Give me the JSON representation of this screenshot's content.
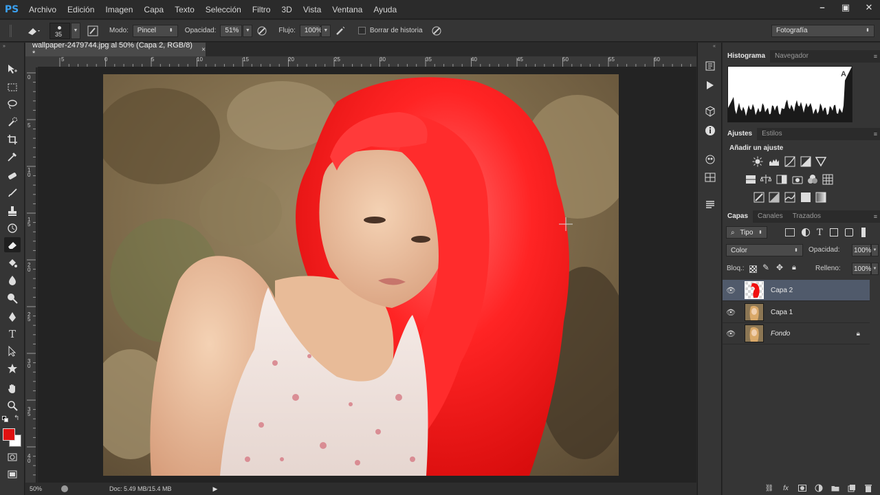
{
  "app": {
    "logo": "PS"
  },
  "menu": [
    "Archivo",
    "Edición",
    "Imagen",
    "Capa",
    "Texto",
    "Selección",
    "Filtro",
    "3D",
    "Vista",
    "Ventana",
    "Ayuda"
  ],
  "window_controls": [
    "–",
    "▣",
    "✕"
  ],
  "options": {
    "brush_size": "35",
    "mode_label": "Modo:",
    "mode_value": "Pincel",
    "opacity_label": "Opacidad:",
    "opacity_value": "51%",
    "flow_label": "Flujo:",
    "flow_value": "100%",
    "history_label": "Borrar de historia",
    "workspace": "Fotografía"
  },
  "document": {
    "tab_title": "wallpaper-2479744.jpg al 50% (Capa 2, RGB/8) *",
    "close": "×",
    "ruler_top": [
      "5",
      "0",
      "5",
      "10",
      "15",
      "20",
      "25",
      "30",
      "35",
      "40",
      "45",
      "50",
      "55",
      "60"
    ],
    "ruler_left": [
      "0",
      "5",
      "1\n0",
      "1\n5",
      "2\n0",
      "2\n5",
      "3\n0",
      "3\n5",
      "4\n0"
    ]
  },
  "status": {
    "zoom": "50%",
    "doc_info": "Doc: 5.49 MB/15.4 MB"
  },
  "panels": {
    "histogram_tabs": [
      "Histograma",
      "Navegador"
    ],
    "histogram_warning": "A",
    "adjust_tabs": [
      "Ajustes",
      "Estilos"
    ],
    "adjust_title": "Añadir un ajuste",
    "layers_tabs": [
      "Capas",
      "Canales",
      "Trazados"
    ],
    "filter_kind": "Tipo",
    "blend_mode": "Color",
    "opacity_label": "Opacidad:",
    "opacity_value": "100%",
    "lock_label": "Bloq.:",
    "fill_label": "Relleno:",
    "fill_value": "100%"
  },
  "layers": [
    {
      "name": "Capa 2",
      "selected": true,
      "locked": false
    },
    {
      "name": "Capa 1",
      "selected": false,
      "locked": false
    },
    {
      "name": "Fondo",
      "selected": false,
      "locked": true
    }
  ],
  "colors": {
    "foreground": "#e01010",
    "background": "#ffffff",
    "hair": "#ff2020",
    "selection": "#505a6b"
  }
}
